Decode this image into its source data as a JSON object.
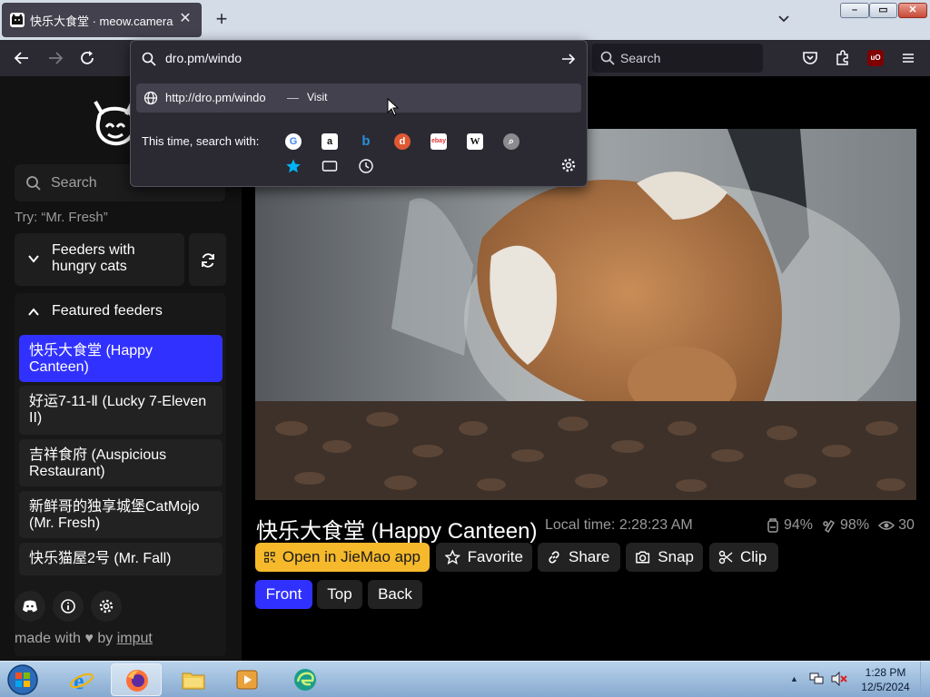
{
  "browser": {
    "tab": {
      "title": "快乐大食堂 · meow.camera",
      "close": "✕"
    },
    "new_tab": "+",
    "tab_list": "⌄",
    "window_controls": {
      "minimize": "–",
      "maximize": "▭",
      "close": "✕"
    },
    "search_placeholder": "Search",
    "icons": [
      "back-icon",
      "forward-icon",
      "reload-icon",
      "pocket-icon",
      "extensions-icon",
      "ublock-icon",
      "menu-icon"
    ],
    "ublock_label": "uO"
  },
  "urlbar": {
    "value": "dro.pm/windo",
    "suggestion": {
      "url": "http://dro.pm/windo",
      "separator": "—",
      "action": "Visit"
    },
    "search_with_label": "This time, search with:",
    "engines": [
      "Google",
      "Amazon",
      "Bing",
      "DuckDuckGo",
      "eBay",
      "Wikipedia",
      "Search",
      "Bookmarks",
      "Tabs",
      "History"
    ]
  },
  "sidebar": {
    "search_placeholder": "Search",
    "hint": "Try: “Mr. Fresh”",
    "hungry_section": "Feeders with hungry cats",
    "featured_section": "Featured feeders",
    "feeders": [
      {
        "label": "快乐大食堂 (Happy Canteen)",
        "active": true
      },
      {
        "label": "好运7-11-Ⅱ (Lucky 7-Eleven II)",
        "active": false
      },
      {
        "label": "吉祥食府 (Auspicious Restaurant)",
        "active": false
      },
      {
        "label": "新鲜哥的独享城堡CatMojo (Mr. Fresh)",
        "active": false
      },
      {
        "label": "快乐猫屋2号 (Mr. Fall)",
        "active": false
      }
    ],
    "footer": {
      "made_with": "made with",
      "heart": "♥",
      "by": "by",
      "author": "imput"
    }
  },
  "camera": {
    "title": "快乐大食堂 (Happy Canteen)",
    "local_time": "Local time: 2:28:23 AM",
    "food_level": "94%",
    "battery": "98%",
    "viewers": "30",
    "actions": {
      "open_app": "Open in JieMao app",
      "favorite": "Favorite",
      "share": "Share",
      "snap": "Snap",
      "clip": "Clip"
    },
    "views": {
      "front": "Front",
      "top": "Top",
      "back": "Back"
    }
  },
  "taskbar": {
    "apps": [
      "internet-explorer",
      "firefox",
      "file-explorer",
      "media-player",
      "edge"
    ],
    "active_app": "firefox",
    "tray_arrow": "▲",
    "time": "1:28 PM",
    "date": "12/5/2024"
  },
  "colors": {
    "accent_blue": "#3131ff",
    "app_button": "#f5b92b",
    "sidebar_bg": "#121212",
    "browser_chrome": "#2b2a33"
  }
}
